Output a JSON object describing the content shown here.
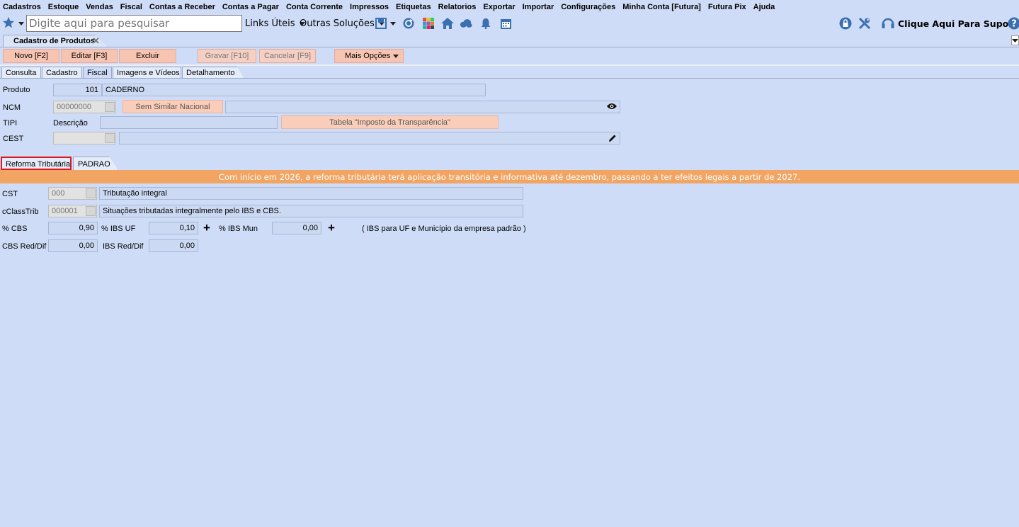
{
  "menu": [
    "Cadastros",
    "Estoque",
    "Vendas",
    "Fiscal",
    "Contas a Receber",
    "Contas a Pagar",
    "Conta Corrente",
    "Impressos",
    "Etiquetas",
    "Relatorios",
    "Exportar",
    "Importar",
    "Configurações",
    "Minha Conta [Futura]",
    "Futura Pix",
    "Ajuda"
  ],
  "toolbar": {
    "search_placeholder": "Digite aqui para pesquisar",
    "links_uteis": "Links Úteis",
    "outras_solucoes": "Outras Soluções",
    "suporte": "Clique Aqui Para Suporte!"
  },
  "doc_tab": {
    "title": "Cadastro de Produtos"
  },
  "actions": {
    "novo": "Novo [F2]",
    "editar": "Editar [F3]",
    "excluir": "Excluir",
    "gravar": "Gravar [F10]",
    "cancelar": "Cancelar [F9]",
    "mais_opcoes": "Mais Opções"
  },
  "section_tabs": [
    "Consulta",
    "Cadastro",
    "Fiscal",
    "Imagens e Vídeos",
    "Detalhamento"
  ],
  "form": {
    "produto_label": "Produto",
    "produto_codigo": "101",
    "produto_nome": "CADERNO",
    "ncm_label": "NCM",
    "ncm_value": "00000000",
    "sem_similar": "Sem Similar Nacional",
    "tipi_label": "TIPI",
    "descricao_label": "Descrição",
    "tabela_imposto": "Tabela \"Imposto da Transparência\"",
    "cest_label": "CEST"
  },
  "lower_tabs": {
    "reforma": "Reforma Tributária",
    "padrao": "PADRAO"
  },
  "banner": "Com início em 2026, a reforma tributária terá aplicação transitória e informativa até dezembro, passando a ter efeitos legais a partir de 2027.",
  "reforma": {
    "cst_label": "CST",
    "cst_code": "000",
    "cst_desc": "Tributação integral",
    "cclass_label": "cClassTrib",
    "cclass_code": "000001",
    "cclass_desc": "Situações tributadas integralmente pelo IBS e CBS.",
    "pct_cbs_label": "% CBS",
    "pct_cbs": "0,90",
    "pct_ibs_uf_label": "% IBS UF",
    "pct_ibs_uf": "0,10",
    "pct_ibs_mun_label": "% IBS Mun",
    "pct_ibs_mun": "0,00",
    "ibs_note": "( IBS para UF e Município da empresa padrão )",
    "cbs_red_label": "CBS Red/Dif",
    "cbs_red": "0,00",
    "ibs_red_label": "IBS Red/Dif",
    "ibs_red": "0,00"
  },
  "colors": {
    "banner": "#f2a462",
    "background": "#cfdcf7",
    "action_button": "#f7c4b2",
    "highlight": "#e0161f"
  }
}
